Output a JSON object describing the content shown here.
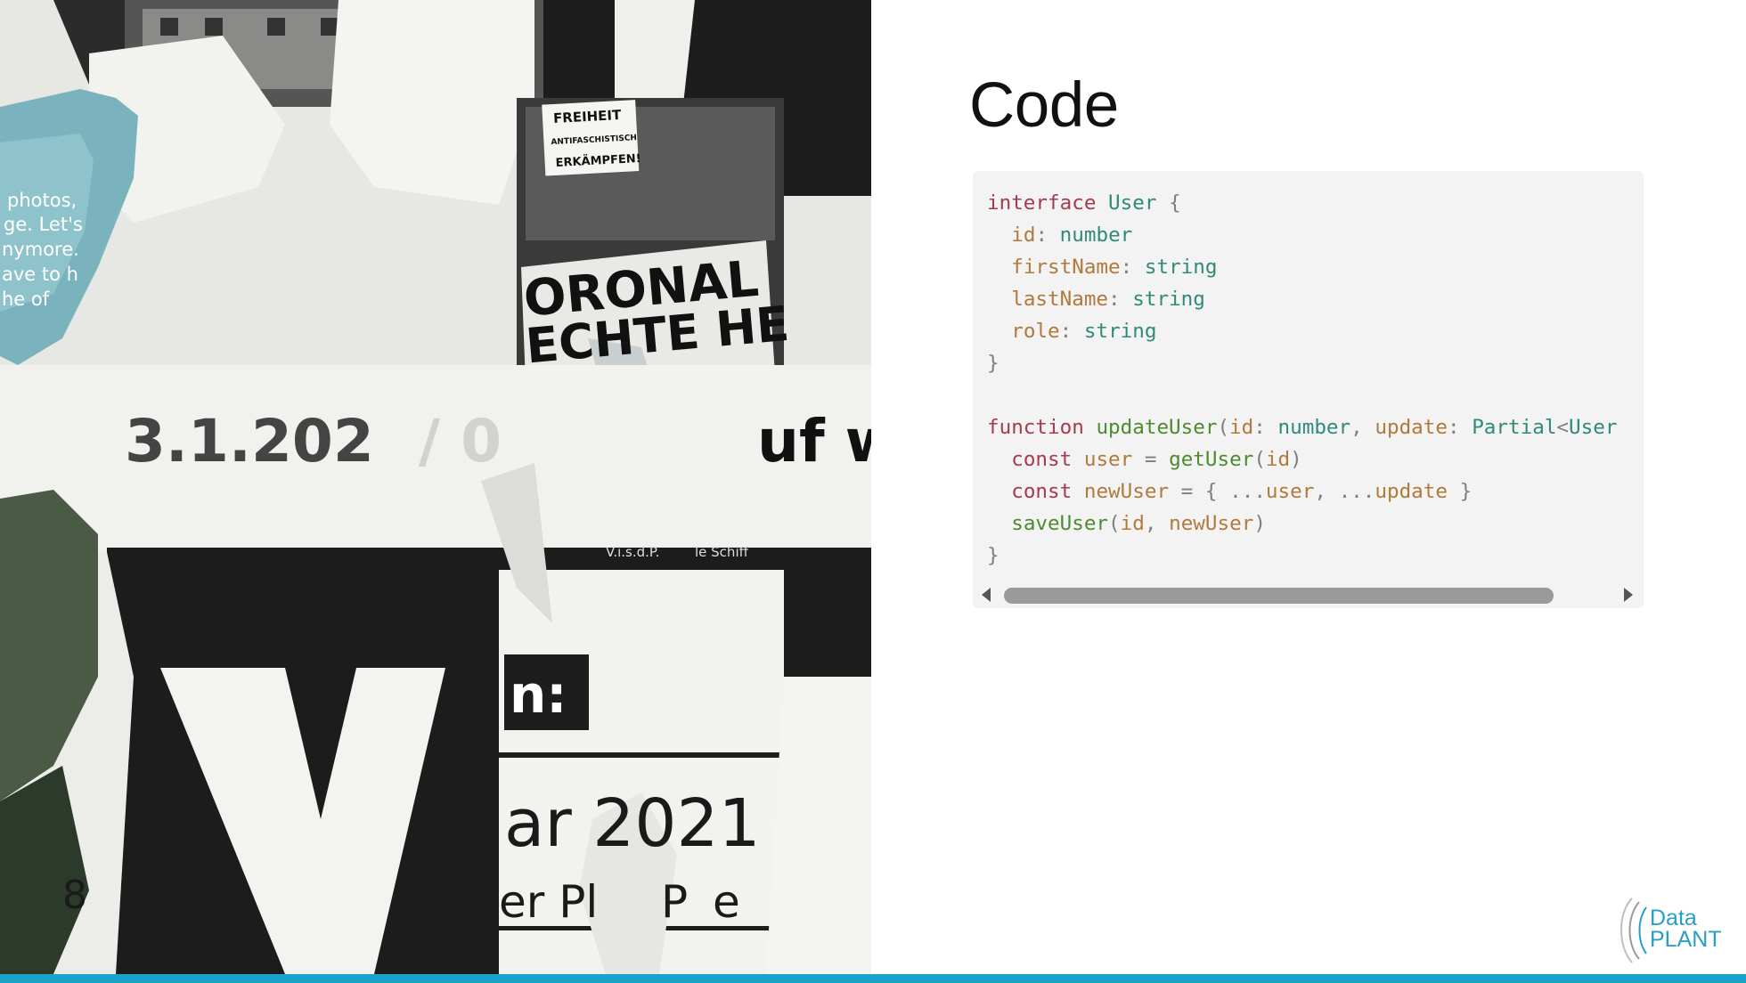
{
  "slide": {
    "title": "Code",
    "accent_color": "#1ba4cb"
  },
  "code": {
    "language": "typescript",
    "lines": [
      "interface User {",
      "  id: number",
      "  firstName: string",
      "  lastName: string",
      "  role: string",
      "}",
      "",
      "function updateUser(id: number, update: Partial<User",
      "  const user = getUser(id)",
      "  const newUser = { ...user, ...update }",
      "  saveUser(id, newUser)",
      "}"
    ]
  },
  "photo": {
    "poster_texts": [
      "photos,",
      "ge. Let's",
      "nymore.",
      "ave to h",
      "he of",
      "FREIHEIT",
      "ANTIFASCHISTISCH",
      "ERKÄMPFEN!",
      "ORONAL",
      "ECHTE HE",
      "3.1.202",
      "/ 0",
      "uf w",
      "V.i.s.d.P.",
      "le Schiff",
      "n:",
      "ar 2021",
      "er Pl",
      "P",
      "e",
      "8"
    ]
  },
  "logo": {
    "line1": "Data",
    "line2": "PLANT",
    "color": "#2a9fc6"
  },
  "scrollbar": {
    "left_arrow_icon": "triangle-left-icon",
    "right_arrow_icon": "triangle-right-icon"
  }
}
